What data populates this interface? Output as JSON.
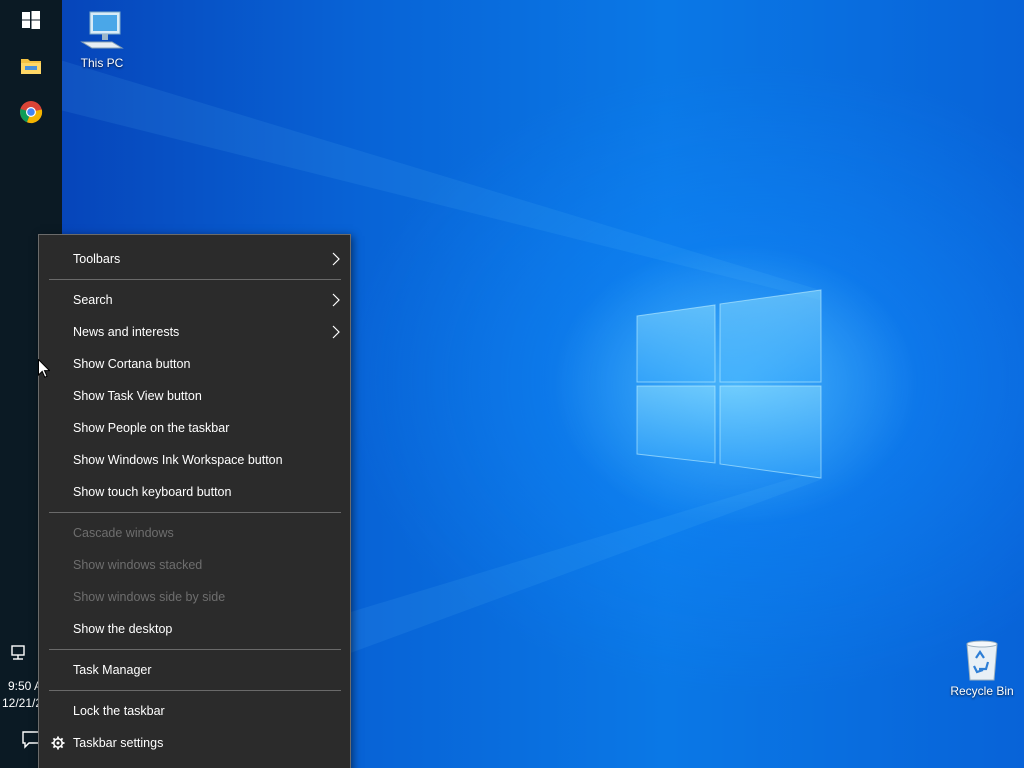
{
  "taskbar": {
    "clock_time": "9:50 A",
    "clock_date": "12/21/2"
  },
  "desktop": {
    "icons": [
      {
        "label": "This PC"
      },
      {
        "label": "Recycle Bin"
      }
    ]
  },
  "context_menu": {
    "items": [
      {
        "label": "Toolbars",
        "submenu": true
      },
      {
        "label": "Search",
        "submenu": true
      },
      {
        "label": "News and interests",
        "submenu": true
      },
      {
        "label": "Show Cortana button"
      },
      {
        "label": "Show Task View button"
      },
      {
        "label": "Show People on the taskbar"
      },
      {
        "label": "Show Windows Ink Workspace button"
      },
      {
        "label": "Show touch keyboard button"
      },
      {
        "label": "Cascade windows",
        "disabled": true
      },
      {
        "label": "Show windows stacked",
        "disabled": true
      },
      {
        "label": "Show windows side by side",
        "disabled": true
      },
      {
        "label": "Show the desktop"
      },
      {
        "label": "Task Manager"
      },
      {
        "label": "Lock the taskbar"
      },
      {
        "label": "Taskbar settings",
        "icon": "gear-icon"
      }
    ]
  },
  "colors": {
    "menu_bg": "#2b2b2b",
    "taskbar_bg": "#0b1a24",
    "disabled_text": "#6e6e6e"
  }
}
